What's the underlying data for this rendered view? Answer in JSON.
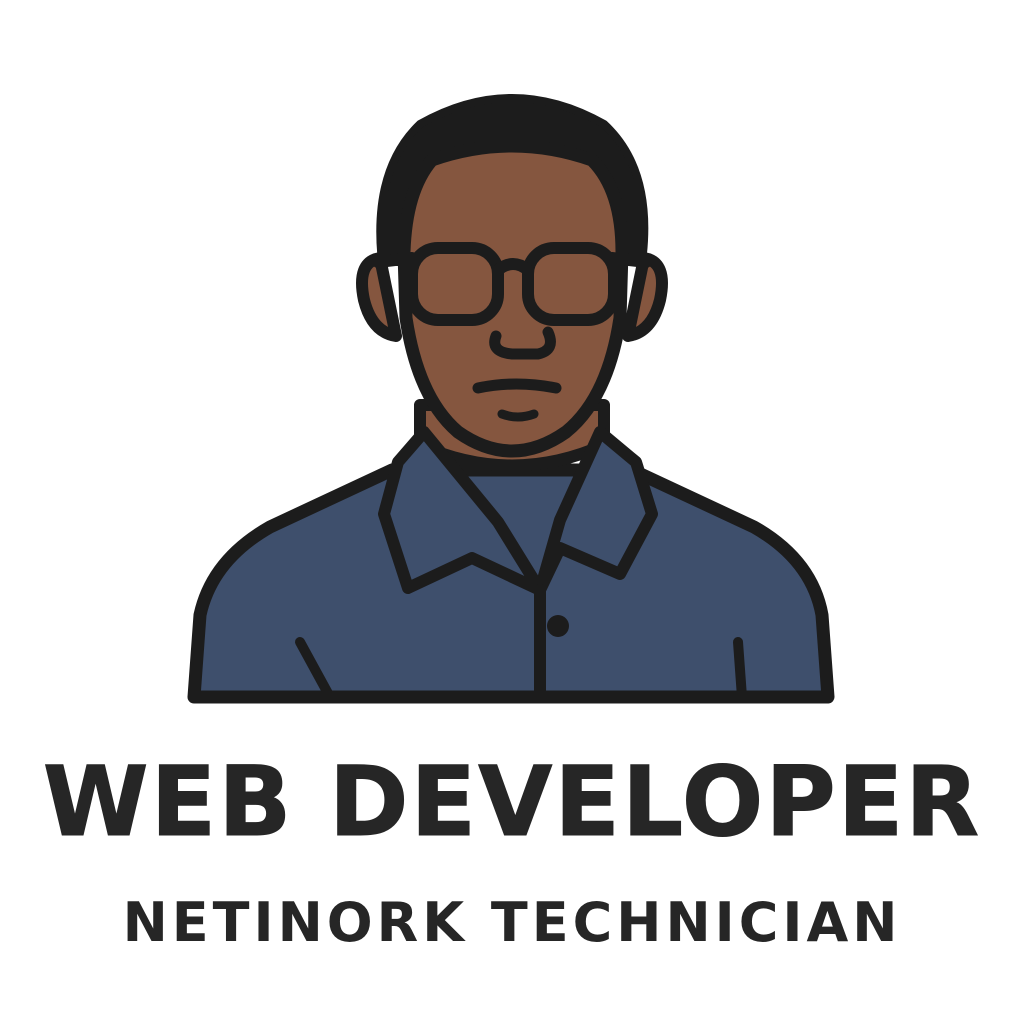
{
  "title": "WEB DEVELOPER",
  "subtitle": "NETINORK TECHNICIAN",
  "illustration": {
    "subject": "person-with-glasses-in-collared-shirt",
    "colors": {
      "skin": "#85563F",
      "hair": "#1C1C1C",
      "shirt": "#3E4F6C",
      "outline": "#1C1C1C",
      "text": "#262626",
      "background": "#FFFFFF"
    }
  }
}
